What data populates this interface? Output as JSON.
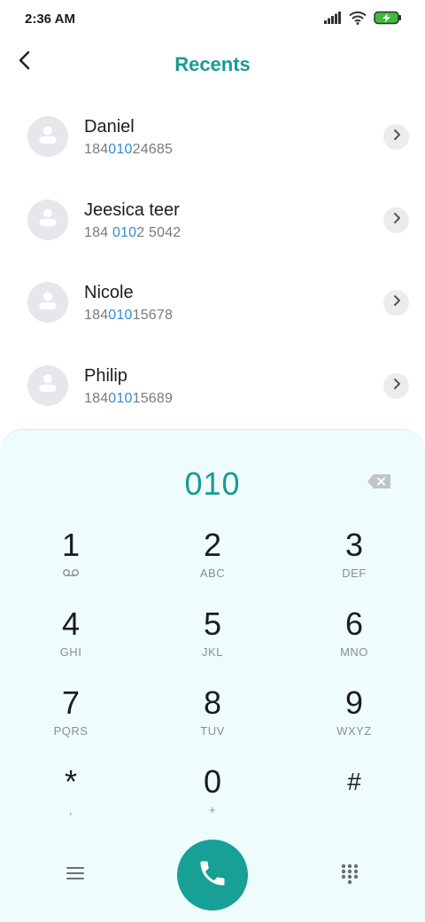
{
  "status": {
    "time": "2:36 AM",
    "icons": [
      "signal-icon",
      "wifi-icon",
      "battery-charging-icon"
    ]
  },
  "header": {
    "title": "Recents",
    "back_icon": "back-arrow-icon"
  },
  "recents": [
    {
      "name": "Daniel",
      "number_pre": "184",
      "number_match": "010",
      "number_post": "24685"
    },
    {
      "name": "Jeesica teer",
      "number_pre": "184 ",
      "number_match": "010",
      "number_post": "2 5042"
    },
    {
      "name": "Nicole",
      "number_pre": "184",
      "number_match": "010",
      "number_post": "15678"
    },
    {
      "name": "Philip",
      "number_pre": "184",
      "number_match": "010",
      "number_post": "15689"
    }
  ],
  "dialer": {
    "input": "010",
    "keys": [
      {
        "digit": "1",
        "letters": ""
      },
      {
        "digit": "2",
        "letters": "ABC"
      },
      {
        "digit": "3",
        "letters": "DEF"
      },
      {
        "digit": "4",
        "letters": "GHI"
      },
      {
        "digit": "5",
        "letters": "JKL"
      },
      {
        "digit": "6",
        "letters": "MNO"
      },
      {
        "digit": "7",
        "letters": "PQRS"
      },
      {
        "digit": "8",
        "letters": "TUV"
      },
      {
        "digit": "9",
        "letters": "WXYZ"
      },
      {
        "digit": "*",
        "letters": ","
      },
      {
        "digit": "0",
        "letters": "+"
      },
      {
        "digit": "#",
        "letters": ""
      }
    ]
  },
  "colors": {
    "accent": "#1a9a93",
    "call_button": "#16a096",
    "match_highlight": "#2e8fd6",
    "dialer_bg": "#effcfc"
  }
}
